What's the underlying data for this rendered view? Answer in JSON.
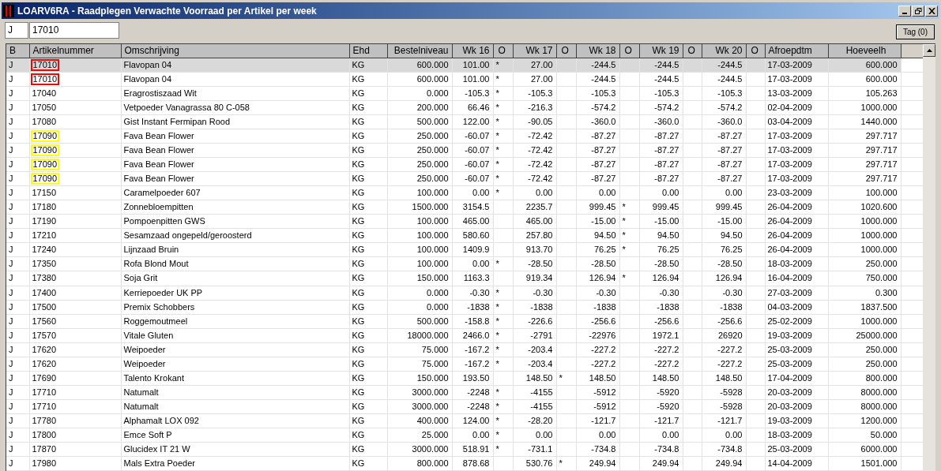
{
  "window": {
    "title": "LOARV6RA - Raadplegen Verwachte Voorraad per Artikel per week"
  },
  "filter": {
    "status": "J",
    "artikelnummer": "17010"
  },
  "tag_button": "Tag (0)",
  "columns": [
    "B",
    "Artikelnummer",
    "Omschrijving",
    "Ehd",
    "Bestelniveau",
    "Wk 16",
    "O",
    "Wk 17",
    "O",
    "Wk 18",
    "O",
    "Wk 19",
    "O",
    "Wk 20",
    "O",
    "Afroepdtm",
    "Hoeveelh"
  ],
  "rows": [
    {
      "selected": true,
      "color": "#ff0000",
      "b": "J",
      "artikel": "17010",
      "omschrijving": "Flavopan 04",
      "ehd": "KG",
      "bestelniveau": "600.000",
      "weeks": [
        {
          "value": "101.00",
          "o": "*"
        },
        {
          "value": "27.00"
        },
        {
          "value": "-244.5"
        },
        {
          "value": "-244.5"
        },
        {
          "value": "-244.5"
        }
      ],
      "afroepdtm": "17-03-2009",
      "hoeveelh": "600.000"
    },
    {
      "selected": false,
      "color": "#ff0000",
      "b": "J",
      "artikel": "17010",
      "omschrijving": "Flavopan 04",
      "ehd": "KG",
      "bestelniveau": "600.000",
      "weeks": [
        {
          "value": "101.00",
          "o": "*"
        },
        {
          "value": "27.00"
        },
        {
          "value": "-244.5"
        },
        {
          "value": "-244.5"
        },
        {
          "value": "-244.5"
        }
      ],
      "afroepdtm": "17-03-2009",
      "hoeveelh": "600.000"
    },
    {
      "selected": false,
      "b": "J",
      "artikel": "17040",
      "omschrijving": "Eragrostiszaad Wit",
      "ehd": "KG",
      "bestelniveau": "0.000",
      "weeks": [
        {
          "value": "-105.3",
          "o": "*"
        },
        {
          "value": "-105.3"
        },
        {
          "value": "-105.3"
        },
        {
          "value": "-105.3"
        },
        {
          "value": "-105.3"
        }
      ],
      "afroepdtm": "13-03-2009",
      "hoeveelh": "105.263"
    },
    {
      "selected": false,
      "b": "J",
      "artikel": "17050",
      "omschrijving": "Vetpoeder Vanagrassa 80 C-058",
      "ehd": "KG",
      "bestelniveau": "200.000",
      "weeks": [
        {
          "value": "66.46",
          "o": "*"
        },
        {
          "value": "-216.3"
        },
        {
          "value": "-574.2"
        },
        {
          "value": "-574.2"
        },
        {
          "value": "-574.2"
        }
      ],
      "afroepdtm": "02-04-2009",
      "hoeveelh": "1000.000"
    },
    {
      "selected": false,
      "b": "J",
      "artikel": "17080",
      "omschrijving": "Gist Instant Fermipan Rood",
      "ehd": "KG",
      "bestelniveau": "500.000",
      "weeks": [
        {
          "value": "122.00",
          "o": "*"
        },
        {
          "value": "-90.05"
        },
        {
          "value": "-360.0"
        },
        {
          "value": "-360.0"
        },
        {
          "value": "-360.0"
        }
      ],
      "afroepdtm": "03-04-2009",
      "hoeveelh": "1440.000"
    },
    {
      "selected": false,
      "color": "#ffff00",
      "b": "J",
      "artikel": "17090",
      "omschrijving": "Fava Bean Flower",
      "ehd": "KG",
      "bestelniveau": "250.000",
      "weeks": [
        {
          "value": "-60.07",
          "o": "*"
        },
        {
          "value": "-72.42"
        },
        {
          "value": "-87.27"
        },
        {
          "value": "-87.27"
        },
        {
          "value": "-87.27"
        }
      ],
      "afroepdtm": "17-03-2009",
      "hoeveelh": "297.717"
    },
    {
      "selected": false,
      "color": "#ffff00",
      "b": "J",
      "artikel": "17090",
      "omschrijving": "Fava Bean Flower",
      "ehd": "KG",
      "bestelniveau": "250.000",
      "weeks": [
        {
          "value": "-60.07",
          "o": "*"
        },
        {
          "value": "-72.42"
        },
        {
          "value": "-87.27"
        },
        {
          "value": "-87.27"
        },
        {
          "value": "-87.27"
        }
      ],
      "afroepdtm": "17-03-2009",
      "hoeveelh": "297.717"
    },
    {
      "selected": false,
      "color": "#ffff00",
      "b": "J",
      "artikel": "17090",
      "omschrijving": "Fava Bean Flower",
      "ehd": "KG",
      "bestelniveau": "250.000",
      "weeks": [
        {
          "value": "-60.07",
          "o": "*"
        },
        {
          "value": "-72.42"
        },
        {
          "value": "-87.27"
        },
        {
          "value": "-87.27"
        },
        {
          "value": "-87.27"
        }
      ],
      "afroepdtm": "17-03-2009",
      "hoeveelh": "297.717"
    },
    {
      "selected": false,
      "color": "#ffff00",
      "b": "J",
      "artikel": "17090",
      "omschrijving": "Fava Bean Flower",
      "ehd": "KG",
      "bestelniveau": "250.000",
      "weeks": [
        {
          "value": "-60.07",
          "o": "*"
        },
        {
          "value": "-72.42"
        },
        {
          "value": "-87.27"
        },
        {
          "value": "-87.27"
        },
        {
          "value": "-87.27"
        }
      ],
      "afroepdtm": "17-03-2009",
      "hoeveelh": "297.717"
    },
    {
      "selected": false,
      "b": "J",
      "artikel": "17150",
      "omschrijving": "Caramelpoeder 607",
      "ehd": "KG",
      "bestelniveau": "100.000",
      "weeks": [
        {
          "value": "0.00",
          "o": "*"
        },
        {
          "value": "0.00"
        },
        {
          "value": "0.00"
        },
        {
          "value": "0.00"
        },
        {
          "value": "0.00"
        }
      ],
      "afroepdtm": "23-03-2009",
      "hoeveelh": "100.000"
    },
    {
      "selected": false,
      "b": "J",
      "artikel": "17180",
      "omschrijving": "Zonnebloempitten",
      "ehd": "KG",
      "bestelniveau": "1500.000",
      "weeks": [
        {
          "value": "3154.5"
        },
        {
          "value": "2235.7"
        },
        {
          "value": "999.45",
          "o": "*"
        },
        {
          "value": "999.45"
        },
        {
          "value": "999.45"
        }
      ],
      "afroepdtm": "26-04-2009",
      "hoeveelh": "1020.600"
    },
    {
      "selected": false,
      "b": "J",
      "artikel": "17190",
      "omschrijving": "Pompoenpitten GWS",
      "ehd": "KG",
      "bestelniveau": "100.000",
      "weeks": [
        {
          "value": "465.00"
        },
        {
          "value": "465.00"
        },
        {
          "value": "-15.00",
          "o": "*"
        },
        {
          "value": "-15.00"
        },
        {
          "value": "-15.00"
        }
      ],
      "afroepdtm": "26-04-2009",
      "hoeveelh": "1000.000"
    },
    {
      "selected": false,
      "b": "J",
      "artikel": "17210",
      "omschrijving": "Sesamzaad ongepeld/geroosterd",
      "ehd": "KG",
      "bestelniveau": "100.000",
      "weeks": [
        {
          "value": "580.60"
        },
        {
          "value": "257.80"
        },
        {
          "value": "94.50",
          "o": "*"
        },
        {
          "value": "94.50"
        },
        {
          "value": "94.50"
        }
      ],
      "afroepdtm": "26-04-2009",
      "hoeveelh": "1000.000"
    },
    {
      "selected": false,
      "b": "J",
      "artikel": "17240",
      "omschrijving": "Lijnzaad Bruin",
      "ehd": "KG",
      "bestelniveau": "100.000",
      "weeks": [
        {
          "value": "1409.9"
        },
        {
          "value": "913.70"
        },
        {
          "value": "76.25",
          "o": "*"
        },
        {
          "value": "76.25"
        },
        {
          "value": "76.25"
        }
      ],
      "afroepdtm": "26-04-2009",
      "hoeveelh": "1000.000"
    },
    {
      "selected": false,
      "b": "J",
      "artikel": "17350",
      "omschrijving": "Rofa Blond Mout",
      "ehd": "KG",
      "bestelniveau": "100.000",
      "weeks": [
        {
          "value": "0.00",
          "o": "*"
        },
        {
          "value": "-28.50"
        },
        {
          "value": "-28.50"
        },
        {
          "value": "-28.50"
        },
        {
          "value": "-28.50"
        }
      ],
      "afroepdtm": "18-03-2009",
      "hoeveelh": "250.000"
    },
    {
      "selected": false,
      "b": "J",
      "artikel": "17380",
      "omschrijving": "Soja Grit",
      "ehd": "KG",
      "bestelniveau": "150.000",
      "weeks": [
        {
          "value": "1163.3"
        },
        {
          "value": "919.34"
        },
        {
          "value": "126.94",
          "o": "*"
        },
        {
          "value": "126.94"
        },
        {
          "value": "126.94"
        }
      ],
      "afroepdtm": "16-04-2009",
      "hoeveelh": "750.000"
    },
    {
      "selected": false,
      "b": "J",
      "artikel": "17400",
      "omschrijving": "Kerriepoeder UK PP",
      "ehd": "KG",
      "bestelniveau": "0.000",
      "weeks": [
        {
          "value": "-0.30",
          "o": "*"
        },
        {
          "value": "-0.30"
        },
        {
          "value": "-0.30"
        },
        {
          "value": "-0.30"
        },
        {
          "value": "-0.30"
        }
      ],
      "afroepdtm": "27-03-2009",
      "hoeveelh": "0.300"
    },
    {
      "selected": false,
      "b": "J",
      "artikel": "17500",
      "omschrijving": "Premix Schobbers",
      "ehd": "KG",
      "bestelniveau": "0.000",
      "weeks": [
        {
          "value": "-1838",
          "o": "*"
        },
        {
          "value": "-1838"
        },
        {
          "value": "-1838"
        },
        {
          "value": "-1838"
        },
        {
          "value": "-1838"
        }
      ],
      "afroepdtm": "04-03-2009",
      "hoeveelh": "1837.500"
    },
    {
      "selected": false,
      "b": "J",
      "artikel": "17560",
      "omschrijving": "Roggemoutmeel",
      "ehd": "KG",
      "bestelniveau": "500.000",
      "weeks": [
        {
          "value": "-158.8",
          "o": "*"
        },
        {
          "value": "-226.6"
        },
        {
          "value": "-256.6"
        },
        {
          "value": "-256.6"
        },
        {
          "value": "-256.6"
        }
      ],
      "afroepdtm": "25-02-2009",
      "hoeveelh": "1000.000"
    },
    {
      "selected": false,
      "b": "J",
      "artikel": "17570",
      "omschrijving": "Vitale Gluten",
      "ehd": "KG",
      "bestelniveau": "18000.000",
      "weeks": [
        {
          "value": "2466.0",
          "o": "*"
        },
        {
          "value": "-2791"
        },
        {
          "value": "-22976"
        },
        {
          "value": "1972.1"
        },
        {
          "value": "26920"
        }
      ],
      "afroepdtm": "19-03-2009",
      "hoeveelh": "25000.000"
    },
    {
      "selected": false,
      "b": "J",
      "artikel": "17620",
      "omschrijving": "Weipoeder",
      "ehd": "KG",
      "bestelniveau": "75.000",
      "weeks": [
        {
          "value": "-167.2",
          "o": "*"
        },
        {
          "value": "-203.4"
        },
        {
          "value": "-227.2"
        },
        {
          "value": "-227.2"
        },
        {
          "value": "-227.2"
        }
      ],
      "afroepdtm": "25-03-2009",
      "hoeveelh": "250.000"
    },
    {
      "selected": false,
      "b": "J",
      "artikel": "17620",
      "omschrijving": "Weipoeder",
      "ehd": "KG",
      "bestelniveau": "75.000",
      "weeks": [
        {
          "value": "-167.2",
          "o": "*"
        },
        {
          "value": "-203.4"
        },
        {
          "value": "-227.2"
        },
        {
          "value": "-227.2"
        },
        {
          "value": "-227.2"
        }
      ],
      "afroepdtm": "25-03-2009",
      "hoeveelh": "250.000"
    },
    {
      "selected": false,
      "b": "J",
      "artikel": "17690",
      "omschrijving": "Talento Krokant",
      "ehd": "KG",
      "bestelniveau": "150.000",
      "weeks": [
        {
          "value": "193.50"
        },
        {
          "value": "148.50",
          "o": "*"
        },
        {
          "value": "148.50"
        },
        {
          "value": "148.50"
        },
        {
          "value": "148.50"
        }
      ],
      "afroepdtm": "17-04-2009",
      "hoeveelh": "800.000"
    },
    {
      "selected": false,
      "b": "J",
      "artikel": "17710",
      "omschrijving": "Natumalt",
      "ehd": "KG",
      "bestelniveau": "3000.000",
      "weeks": [
        {
          "value": "-2248",
          "o": "*"
        },
        {
          "value": "-4155"
        },
        {
          "value": "-5912"
        },
        {
          "value": "-5920"
        },
        {
          "value": "-5928"
        }
      ],
      "afroepdtm": "20-03-2009",
      "hoeveelh": "8000.000"
    },
    {
      "selected": false,
      "b": "J",
      "artikel": "17710",
      "omschrijving": "Natumalt",
      "ehd": "KG",
      "bestelniveau": "3000.000",
      "weeks": [
        {
          "value": "-2248",
          "o": "*"
        },
        {
          "value": "-4155"
        },
        {
          "value": "-5912"
        },
        {
          "value": "-5920"
        },
        {
          "value": "-5928"
        }
      ],
      "afroepdtm": "20-03-2009",
      "hoeveelh": "8000.000"
    },
    {
      "selected": false,
      "b": "J",
      "artikel": "17780",
      "omschrijving": "Alphamalt LOX 092",
      "ehd": "KG",
      "bestelniveau": "400.000",
      "weeks": [
        {
          "value": "124.00",
          "o": "*"
        },
        {
          "value": "-28.20"
        },
        {
          "value": "-121.7"
        },
        {
          "value": "-121.7"
        },
        {
          "value": "-121.7"
        }
      ],
      "afroepdtm": "19-03-2009",
      "hoeveelh": "1200.000"
    },
    {
      "selected": false,
      "b": "J",
      "artikel": "17800",
      "omschrijving": "Emce Soft P",
      "ehd": "KG",
      "bestelniveau": "25.000",
      "weeks": [
        {
          "value": "0.00",
          "o": "*"
        },
        {
          "value": "0.00"
        },
        {
          "value": "0.00"
        },
        {
          "value": "0.00"
        },
        {
          "value": "0.00"
        }
      ],
      "afroepdtm": "18-03-2009",
      "hoeveelh": "50.000"
    },
    {
      "selected": false,
      "b": "J",
      "artikel": "17870",
      "omschrijving": "Glucidex IT 21 W",
      "ehd": "KG",
      "bestelniveau": "3000.000",
      "weeks": [
        {
          "value": "518.91",
          "o": "*"
        },
        {
          "value": "-731.1"
        },
        {
          "value": "-734.8"
        },
        {
          "value": "-734.8"
        },
        {
          "value": "-734.8"
        }
      ],
      "afroepdtm": "25-03-2009",
      "hoeveelh": "6000.000"
    },
    {
      "selected": false,
      "b": "J",
      "artikel": "17980",
      "omschrijving": "Mals Extra Poeder",
      "ehd": "KG",
      "bestelniveau": "800.000",
      "weeks": [
        {
          "value": "878.68"
        },
        {
          "value": "530.76",
          "o": "*"
        },
        {
          "value": "249.94"
        },
        {
          "value": "249.94"
        },
        {
          "value": "249.94"
        }
      ],
      "afroepdtm": "14-04-2009",
      "hoeveelh": "1501.000"
    }
  ]
}
